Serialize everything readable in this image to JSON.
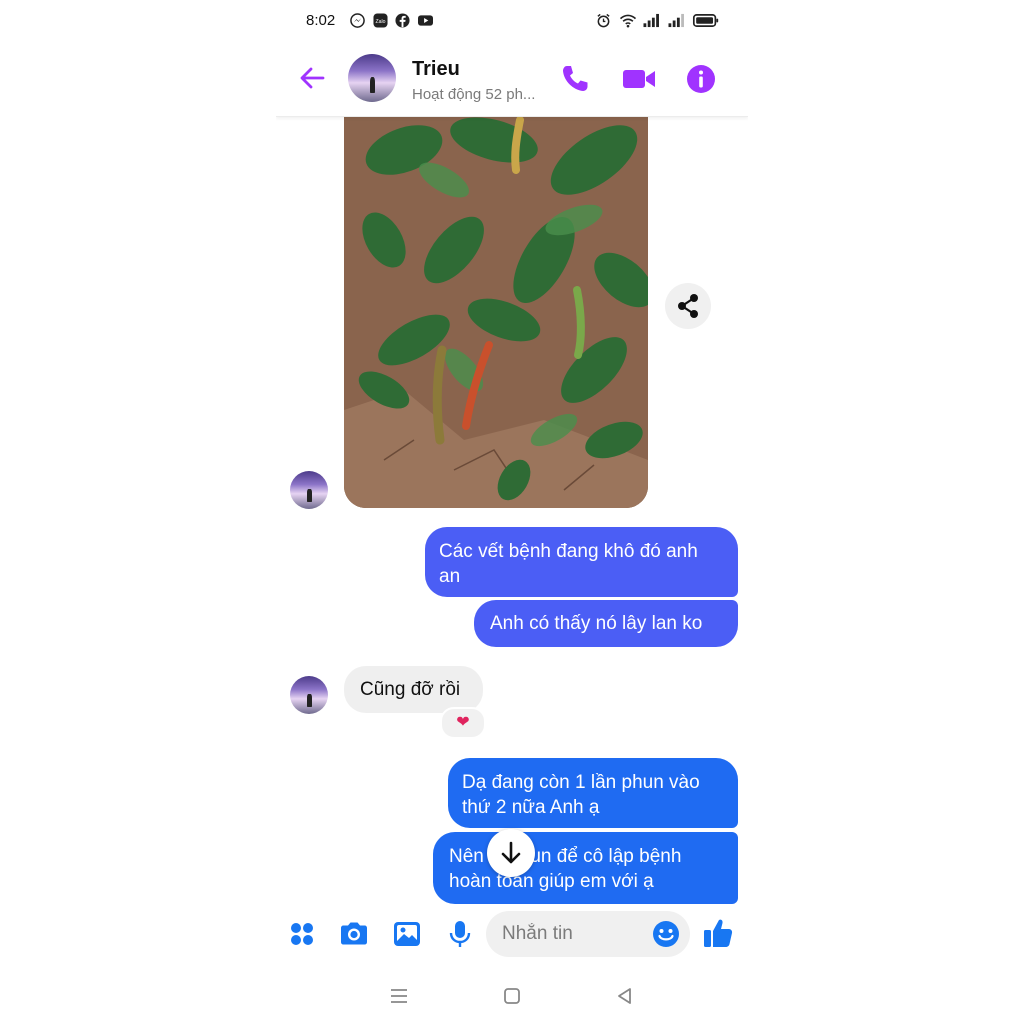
{
  "status": {
    "time": "8:02",
    "app_icons": [
      "messenger-icon",
      "zalo-icon",
      "facebook-icon",
      "youtube-icon"
    ],
    "zalo_text": "Zalo",
    "right_icons": [
      "alarm-icon",
      "wifi-icon",
      "signal-icon",
      "signal-icon",
      "battery-icon"
    ]
  },
  "header": {
    "name": "Trieu",
    "activity": "Hoạt động 52 ph..."
  },
  "messages": [
    {
      "type": "image",
      "sender": "contact",
      "description_icon": "photo-message"
    },
    {
      "sender": "me",
      "text": "Các vết bệnh đang khô đó anh an"
    },
    {
      "sender": "me",
      "text": "Anh có thấy nó lây lan ko"
    },
    {
      "sender": "contact",
      "text": "Cũng đỡ rồi",
      "reaction": "❤"
    },
    {
      "sender": "me",
      "text": "Dạ đang còn 1 lần phun vào thứ 2 nữa Anh ạ"
    },
    {
      "sender": "me",
      "text": "Nên lo phun để cô lập bệnh hoàn toàn giúp em với ạ"
    }
  ],
  "composer": {
    "placeholder": "Nhắn tin"
  },
  "colors": {
    "accent": "#a033ff",
    "outgoing_bubble": "#4b5ef5",
    "outgoing_bubble_alt": "#1f6bf2",
    "incoming_bubble": "#efefef",
    "composer_icon": "#1877f2"
  }
}
